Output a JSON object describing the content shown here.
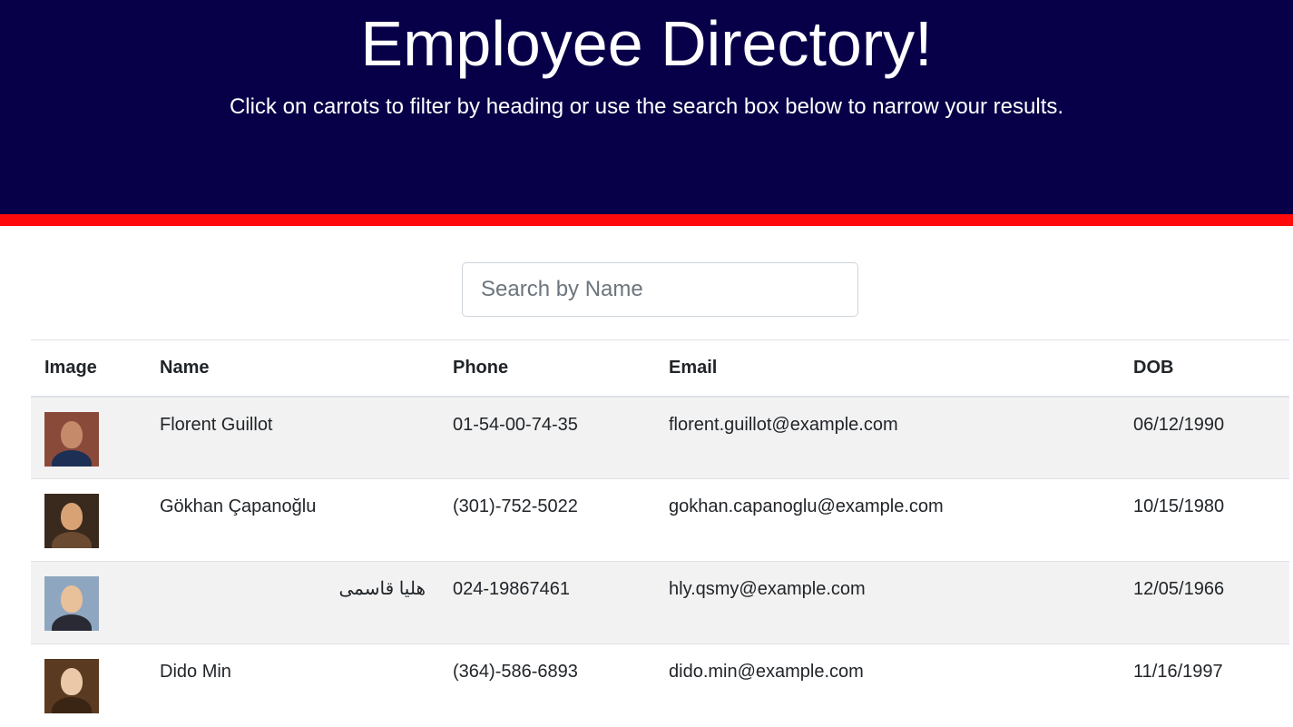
{
  "header": {
    "title": "Employee Directory!",
    "subtitle": "Click on carrots to filter by heading or use the search box below to narrow your results."
  },
  "colors": {
    "header_bg": "#070048",
    "accent_bar": "#ff0a0a",
    "row_stripe": "#f2f2f2"
  },
  "search": {
    "placeholder": "Search by Name",
    "value": ""
  },
  "table": {
    "columns": [
      "Image",
      "Name",
      "Phone",
      "Email",
      "DOB"
    ],
    "rows": [
      {
        "image": "employee-photo",
        "name": "Florent Guillot",
        "phone": "01-54-00-74-35",
        "email": "florent.guillot@example.com",
        "dob": "06/12/1990",
        "photo_colors": {
          "bg": "#8a4a3a",
          "face": "#c48a6a",
          "body": "#1d2f55"
        }
      },
      {
        "image": "employee-photo",
        "name": "Gökhan Çapanoğlu",
        "phone": "(301)-752-5022",
        "email": "gokhan.capanoglu@example.com",
        "dob": "10/15/1980",
        "photo_colors": {
          "bg": "#3a2a1e",
          "face": "#d9a275",
          "body": "#6a4a30"
        }
      },
      {
        "image": "employee-photo",
        "name": "هليا قاسمی",
        "phone": "024-19867461",
        "email": "hly.qsmy@example.com",
        "dob": "12/05/1966",
        "photo_colors": {
          "bg": "#8fa6c0",
          "face": "#e8c09a",
          "body": "#2a2a35"
        }
      },
      {
        "image": "employee-photo",
        "name": "Dido Min",
        "phone": "(364)-586-6893",
        "email": "dido.min@example.com",
        "dob": "11/16/1997",
        "photo_colors": {
          "bg": "#5a3a20",
          "face": "#eac8a8",
          "body": "#3a2414"
        }
      }
    ]
  }
}
